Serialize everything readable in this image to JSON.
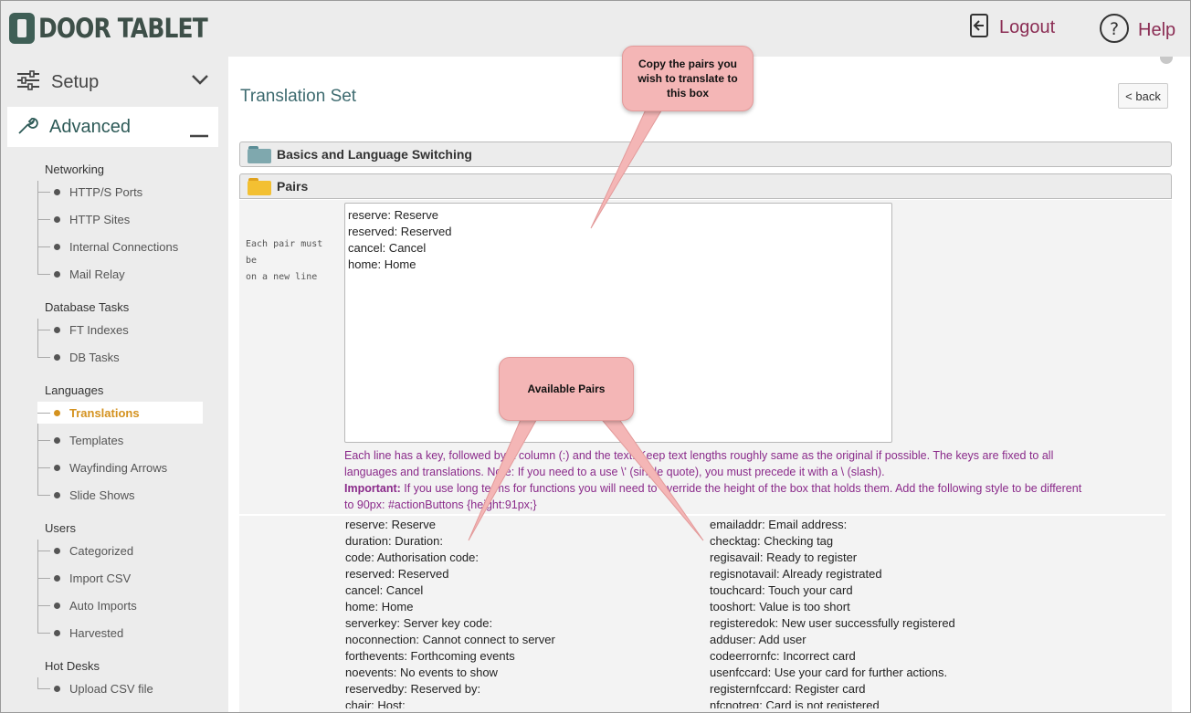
{
  "header": {
    "brand": "DOOR TABLET",
    "logout_label": "Logout",
    "help_label": "Help"
  },
  "sidebar": {
    "setup_label": "Setup",
    "advanced_label": "Advanced",
    "sections": [
      {
        "title": "Networking",
        "items": [
          "HTTP/S Ports",
          "HTTP Sites",
          "Internal Connections",
          "Mail Relay"
        ]
      },
      {
        "title": "Database Tasks",
        "items": [
          "FT Indexes",
          "DB Tasks"
        ]
      },
      {
        "title": "Languages",
        "items": [
          "Translations",
          "Templates",
          "Wayfinding Arrows",
          "Slide Shows"
        ]
      },
      {
        "title": "Users",
        "items": [
          "Categorized",
          "Import CSV",
          "Auto Imports",
          "Harvested"
        ]
      },
      {
        "title": "Hot Desks",
        "items": [
          "Upload CSV file"
        ]
      }
    ],
    "selected_item": "Translations"
  },
  "main": {
    "title": "Translation Set",
    "back_label": "< back",
    "panels": {
      "basics": "Basics and Language Switching",
      "pairs": "Pairs"
    },
    "hint": [
      "Each pair must",
      "be",
      "on a new line"
    ],
    "textarea_value": "reserve: Reserve\nreserved: Reserved\ncancel: Cancel\nhome: Home",
    "notes": {
      "line1": "Each line has a key, followed by a column (:) and the text. Keep text lengths roughly same as the original if possible. The keys are fixed to all",
      "line2": "languages and translations. Note: If you need to a use \\' (single quote), you must precede it with a \\ (slash).",
      "important_label": "Important:",
      "line3": " If you use long terms for functions you will need to override the height of the box that holds them. Add the following style to be different",
      "line4": "to 90px: #actionButtons {height:91px;}"
    },
    "available_left": [
      "reserve: Reserve",
      "duration: Duration:",
      "code: Authorisation code:",
      "reserved: Reserved",
      "cancel: Cancel",
      "home: Home",
      "serverkey: Server key code:",
      "noconnection: Cannot connect to server",
      "forthevents: Forthcoming events",
      "noevents: No events to show",
      "reservedby: Reserved by:",
      "chair: Host:"
    ],
    "available_right": [
      "emailaddr: Email address:",
      "checktag: Checking tag",
      "regisavail: Ready to register",
      "regisnotavail: Already registrated",
      "touchcard: Touch your card",
      "tooshort: Value is too short",
      "registeredok: New user successfully registered",
      "adduser: Add user",
      "codeerrornfc: Incorrect card",
      "usenfccard: Use your card for further actions.",
      "registernfccard: Register card",
      "nfcnotreg: Card is not registered"
    ]
  },
  "callouts": {
    "copy": "Copy the pairs you wish to translate to this box",
    "available": "Available Pairs"
  },
  "colors": {
    "accent": "#8b2d54",
    "selected": "#d4921f",
    "callout": "#f4b6b6",
    "note": "#8a2a8a"
  }
}
